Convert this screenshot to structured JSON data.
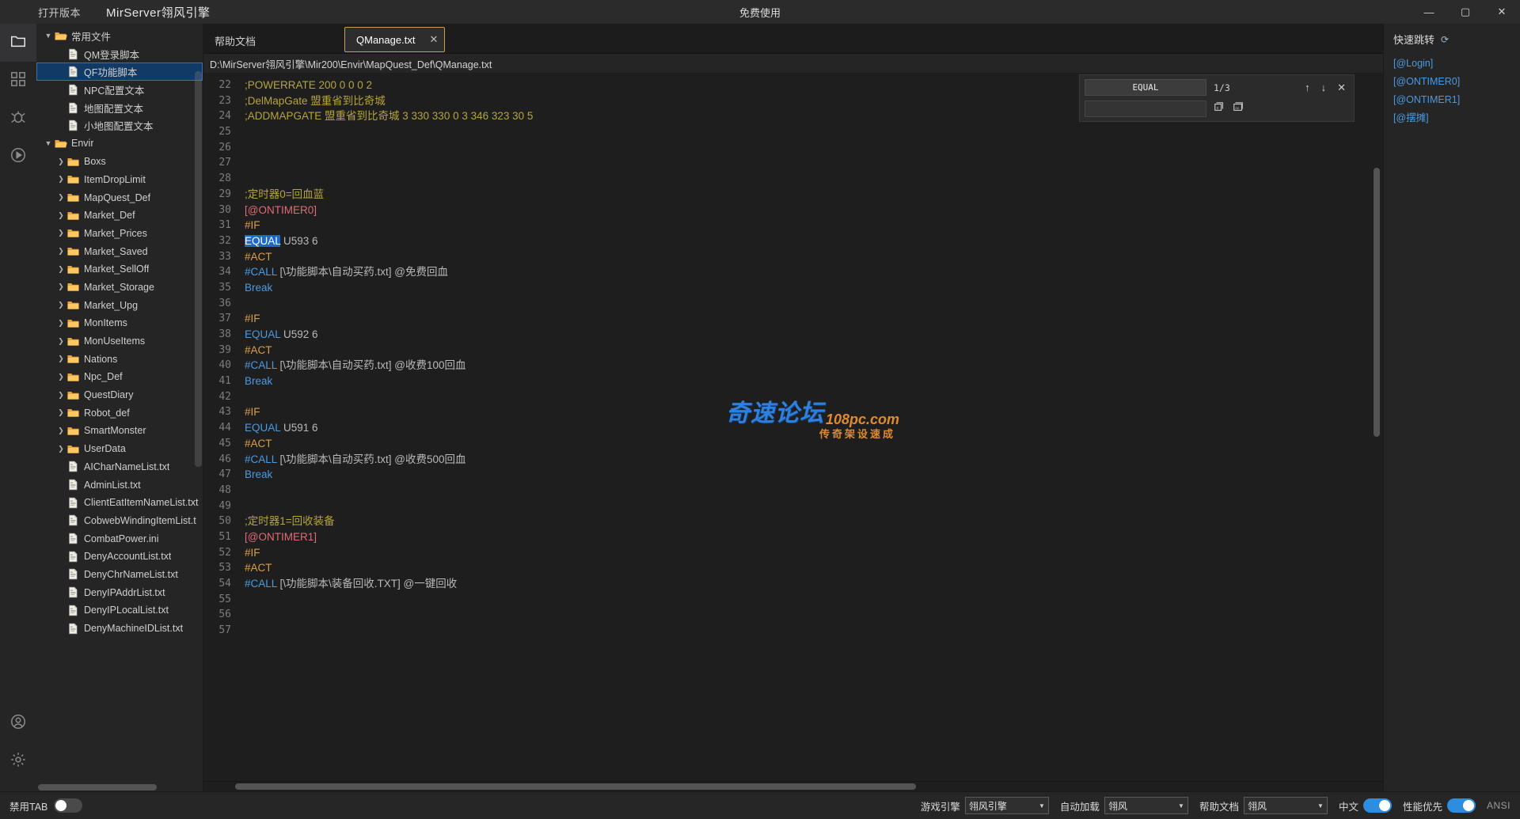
{
  "titlebar": {
    "version_button": "打开版本",
    "app_name": "MirServer翎风引擎",
    "center_text": "免费使用",
    "minimize": "—",
    "maximize": "▢",
    "close": "✕"
  },
  "rail": {
    "items": [
      {
        "name": "explorer-icon",
        "label": "资源管理器"
      },
      {
        "name": "grid-icon",
        "label": "模块"
      },
      {
        "name": "bug-icon",
        "label": "调试"
      },
      {
        "name": "run-icon",
        "label": "运行"
      },
      {
        "name": "account-icon",
        "label": "账户"
      },
      {
        "name": "settings-icon",
        "label": "设置"
      }
    ]
  },
  "explorer": {
    "nodes": [
      {
        "label": "常用文件",
        "depth": 0,
        "type": "folder-open",
        "chev": "v",
        "selected": false
      },
      {
        "label": "QM登录脚本",
        "depth": 1,
        "type": "file",
        "chev": "",
        "selected": false
      },
      {
        "label": "QF功能脚本",
        "depth": 1,
        "type": "file",
        "chev": "",
        "selected": true
      },
      {
        "label": "NPC配置文本",
        "depth": 1,
        "type": "file",
        "chev": "",
        "selected": false
      },
      {
        "label": "地图配置文本",
        "depth": 1,
        "type": "file",
        "chev": "",
        "selected": false
      },
      {
        "label": "小地图配置文本",
        "depth": 1,
        "type": "file",
        "chev": "",
        "selected": false
      },
      {
        "label": "Envir",
        "depth": 0,
        "type": "folder-open",
        "chev": "v",
        "selected": false
      },
      {
        "label": "Boxs",
        "depth": 1,
        "type": "folder",
        "chev": ">",
        "selected": false
      },
      {
        "label": "ItemDropLimit",
        "depth": 1,
        "type": "folder",
        "chev": ">",
        "selected": false
      },
      {
        "label": "MapQuest_Def",
        "depth": 1,
        "type": "folder",
        "chev": ">",
        "selected": false
      },
      {
        "label": "Market_Def",
        "depth": 1,
        "type": "folder",
        "chev": ">",
        "selected": false
      },
      {
        "label": "Market_Prices",
        "depth": 1,
        "type": "folder",
        "chev": ">",
        "selected": false
      },
      {
        "label": "Market_Saved",
        "depth": 1,
        "type": "folder",
        "chev": ">",
        "selected": false
      },
      {
        "label": "Market_SellOff",
        "depth": 1,
        "type": "folder",
        "chev": ">",
        "selected": false
      },
      {
        "label": "Market_Storage",
        "depth": 1,
        "type": "folder",
        "chev": ">",
        "selected": false
      },
      {
        "label": "Market_Upg",
        "depth": 1,
        "type": "folder",
        "chev": ">",
        "selected": false
      },
      {
        "label": "MonItems",
        "depth": 1,
        "type": "folder",
        "chev": ">",
        "selected": false
      },
      {
        "label": "MonUseItems",
        "depth": 1,
        "type": "folder",
        "chev": ">",
        "selected": false
      },
      {
        "label": "Nations",
        "depth": 1,
        "type": "folder",
        "chev": ">",
        "selected": false
      },
      {
        "label": "Npc_Def",
        "depth": 1,
        "type": "folder",
        "chev": ">",
        "selected": false
      },
      {
        "label": "QuestDiary",
        "depth": 1,
        "type": "folder",
        "chev": ">",
        "selected": false
      },
      {
        "label": "Robot_def",
        "depth": 1,
        "type": "folder",
        "chev": ">",
        "selected": false
      },
      {
        "label": "SmartMonster",
        "depth": 1,
        "type": "folder",
        "chev": ">",
        "selected": false
      },
      {
        "label": "UserData",
        "depth": 1,
        "type": "folder",
        "chev": ">",
        "selected": false
      },
      {
        "label": "AICharNameList.txt",
        "depth": 1,
        "type": "file",
        "chev": "",
        "selected": false
      },
      {
        "label": "AdminList.txt",
        "depth": 1,
        "type": "file",
        "chev": "",
        "selected": false
      },
      {
        "label": "ClientEatItemNameList.txt",
        "depth": 1,
        "type": "file",
        "chev": "",
        "selected": false
      },
      {
        "label": "CobwebWindingItemList.t",
        "depth": 1,
        "type": "file",
        "chev": "",
        "selected": false
      },
      {
        "label": "CombatPower.ini",
        "depth": 1,
        "type": "file",
        "chev": "",
        "selected": false
      },
      {
        "label": "DenyAccountList.txt",
        "depth": 1,
        "type": "file",
        "chev": "",
        "selected": false
      },
      {
        "label": "DenyChrNameList.txt",
        "depth": 1,
        "type": "file",
        "chev": "",
        "selected": false
      },
      {
        "label": "DenyIPAddrList.txt",
        "depth": 1,
        "type": "file",
        "chev": "",
        "selected": false
      },
      {
        "label": "DenyIPLocalList.txt",
        "depth": 1,
        "type": "file",
        "chev": "",
        "selected": false
      },
      {
        "label": "DenyMachineIDList.txt",
        "depth": 1,
        "type": "file",
        "chev": "",
        "selected": false
      }
    ]
  },
  "tabs": {
    "help_tab": "帮助文档",
    "active_tab": "QManage.txt",
    "close_glyph": "✕"
  },
  "pathbar": {
    "path": "D:\\MirServer翎风引擎\\Mir200\\Envir\\MapQuest_Def\\QManage.txt"
  },
  "find": {
    "query": "EQUAL",
    "count": "1/3",
    "replace_value": "",
    "prev_glyph": "↑",
    "next_glyph": "↓",
    "close_glyph": "✕"
  },
  "editor": {
    "first_line": 22,
    "lines": [
      {
        "n": 22,
        "tokens": [
          {
            "t": ";POWERRATE 200 0 0 0 2",
            "c": "c-comment"
          }
        ]
      },
      {
        "n": 23,
        "tokens": [
          {
            "t": ";DelMapGate 盟重省到比奇城",
            "c": "c-comment"
          }
        ]
      },
      {
        "n": 24,
        "tokens": [
          {
            "t": ";ADDMAPGATE 盟重省到比奇城 3 330 330 0 3 346 323 30 5",
            "c": "c-comment"
          }
        ]
      },
      {
        "n": 25,
        "tokens": []
      },
      {
        "n": 26,
        "tokens": []
      },
      {
        "n": 27,
        "tokens": []
      },
      {
        "n": 28,
        "tokens": []
      },
      {
        "n": 29,
        "tokens": [
          {
            "t": ";定时器0=回血蓝",
            "c": "c-comment"
          }
        ]
      },
      {
        "n": 30,
        "tokens": [
          {
            "t": "[@ONTIMER0]",
            "c": "c-label"
          }
        ]
      },
      {
        "n": 31,
        "tokens": [
          {
            "t": "#IF",
            "c": "c-hash"
          }
        ]
      },
      {
        "n": 32,
        "tokens": [
          {
            "t": "EQUAL",
            "c": "c-sel"
          },
          {
            "t": " U593 6",
            "c": "c-plain"
          }
        ]
      },
      {
        "n": 33,
        "tokens": [
          {
            "t": "#ACT",
            "c": "c-hash"
          }
        ]
      },
      {
        "n": 34,
        "tokens": [
          {
            "t": "#CALL",
            "c": "c-cmd"
          },
          {
            "t": " [\\功能脚本\\自动买药.txt] @免费回血",
            "c": "c-plain"
          }
        ]
      },
      {
        "n": 35,
        "tokens": [
          {
            "t": "Break",
            "c": "c-break"
          }
        ]
      },
      {
        "n": 36,
        "tokens": []
      },
      {
        "n": 37,
        "tokens": [
          {
            "t": "#IF",
            "c": "c-hash"
          }
        ]
      },
      {
        "n": 38,
        "tokens": [
          {
            "t": "EQUAL",
            "c": "c-cmd"
          },
          {
            "t": " U592 6",
            "c": "c-plain"
          }
        ]
      },
      {
        "n": 39,
        "tokens": [
          {
            "t": "#ACT",
            "c": "c-hash"
          }
        ]
      },
      {
        "n": 40,
        "tokens": [
          {
            "t": "#CALL",
            "c": "c-cmd"
          },
          {
            "t": " [\\功能脚本\\自动买药.txt] @收费100回血",
            "c": "c-plain"
          }
        ]
      },
      {
        "n": 41,
        "tokens": [
          {
            "t": "Break",
            "c": "c-break"
          }
        ]
      },
      {
        "n": 42,
        "tokens": []
      },
      {
        "n": 43,
        "tokens": [
          {
            "t": "#IF",
            "c": "c-hash"
          }
        ]
      },
      {
        "n": 44,
        "tokens": [
          {
            "t": "EQUAL",
            "c": "c-cmd"
          },
          {
            "t": " U591 6",
            "c": "c-plain"
          }
        ]
      },
      {
        "n": 45,
        "tokens": [
          {
            "t": "#ACT",
            "c": "c-hash"
          }
        ]
      },
      {
        "n": 46,
        "tokens": [
          {
            "t": "#CALL",
            "c": "c-cmd"
          },
          {
            "t": " [\\功能脚本\\自动买药.txt] @收费500回血",
            "c": "c-plain"
          }
        ]
      },
      {
        "n": 47,
        "tokens": [
          {
            "t": "Break",
            "c": "c-break"
          }
        ]
      },
      {
        "n": 48,
        "tokens": []
      },
      {
        "n": 49,
        "tokens": []
      },
      {
        "n": 50,
        "tokens": [
          {
            "t": ";定时器1=回收装备",
            "c": "c-comment"
          }
        ]
      },
      {
        "n": 51,
        "tokens": [
          {
            "t": "[@ONTIMER1]",
            "c": "c-label"
          }
        ]
      },
      {
        "n": 52,
        "tokens": [
          {
            "t": "#IF",
            "c": "c-hash"
          }
        ]
      },
      {
        "n": 53,
        "tokens": [
          {
            "t": "#ACT",
            "c": "c-hash"
          }
        ]
      },
      {
        "n": 54,
        "tokens": [
          {
            "t": "#CALL",
            "c": "c-cmd"
          },
          {
            "t": " [\\功能脚本\\装备回收.TXT] @一键回收",
            "c": "c-plain"
          }
        ]
      },
      {
        "n": 55,
        "tokens": []
      },
      {
        "n": 56,
        "tokens": []
      },
      {
        "n": 57,
        "tokens": []
      }
    ]
  },
  "rightpanel": {
    "title": "快速跳转",
    "refresh_glyph": "⟳",
    "links": [
      "[@Login]",
      "[@ONTIMER0]",
      "[@ONTIMER1]",
      "[@摆摊]"
    ]
  },
  "watermark": {
    "line1": "奇速论坛",
    "line2": "108pc.com",
    "line3": "传奇架设速成"
  },
  "statusbar": {
    "tab_disable_label": "禁用TAB",
    "tab_disable_on": false,
    "engine_label": "游戏引擎",
    "engine_value": "翎风引擎",
    "autoload_label": "自动加载",
    "autoload_value": "翎风",
    "helpdoc_label": "帮助文档",
    "helpdoc_value": "翎风",
    "lang_label": "中文",
    "lang_on": true,
    "perf_label": "性能优先",
    "perf_on": true,
    "encoding": "ANSI",
    "arrow_glyph": "▼"
  },
  "colors": {
    "accent_blue": "#2f8de0",
    "tab_border": "#c8a24a",
    "selection": "#1b6ac9",
    "comment": "#b5a43a",
    "label": "#e06c75",
    "link": "#4a9ae0"
  }
}
